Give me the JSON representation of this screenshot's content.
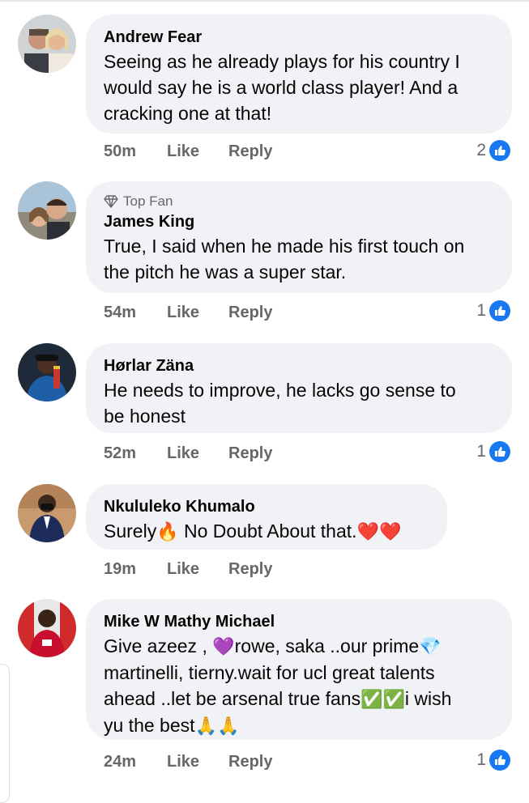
{
  "comments": [
    {
      "name": "Andrew Fear",
      "lines": [
        "Seeing as he already plays for his country I",
        "would say he is a world class player! And a",
        "cracking one at that!"
      ],
      "time": "50m",
      "like": "Like",
      "reply": "Reply",
      "reactions": "2"
    },
    {
      "badge": "Top Fan",
      "name": "James King",
      "lines": [
        "True, I said when he made his first touch on",
        "the pitch he was a super star."
      ],
      "time": "54m",
      "like": "Like",
      "reply": "Reply",
      "reactions": "1"
    },
    {
      "name": "Hørlar Zäna",
      "lines": [
        "He needs to improve, he lacks go sense to",
        "be honest"
      ],
      "time": "52m",
      "like": "Like",
      "reply": "Reply",
      "reactions": "1"
    },
    {
      "name": "Nkululeko Khumalo",
      "line_a": "Surely",
      "line_b": " No Doubt About that.",
      "time": "19m",
      "like": "Like",
      "reply": "Reply"
    },
    {
      "name": "Mike W Mathy Michael",
      "l1a": "Give azeez , ",
      "l1b": "rowe, saka ..our prime",
      "l2": "martinelli, tierny.wait for ucl great talents",
      "l3a": "ahead ..let be arsenal true fans",
      "l3b": "i wish",
      "l4": "yu the best",
      "time": "24m",
      "like": "Like",
      "reply": "Reply",
      "reactions": "1"
    }
  ],
  "icons": {
    "fire": "🔥",
    "heart": "❤️",
    "purple_heart": "💜",
    "gem": "💎",
    "check": "✅",
    "pray": "🙏"
  },
  "colors": {
    "bubble": "#f0f2f5",
    "meta": "#65676b",
    "like_blue": "#1877f2"
  }
}
